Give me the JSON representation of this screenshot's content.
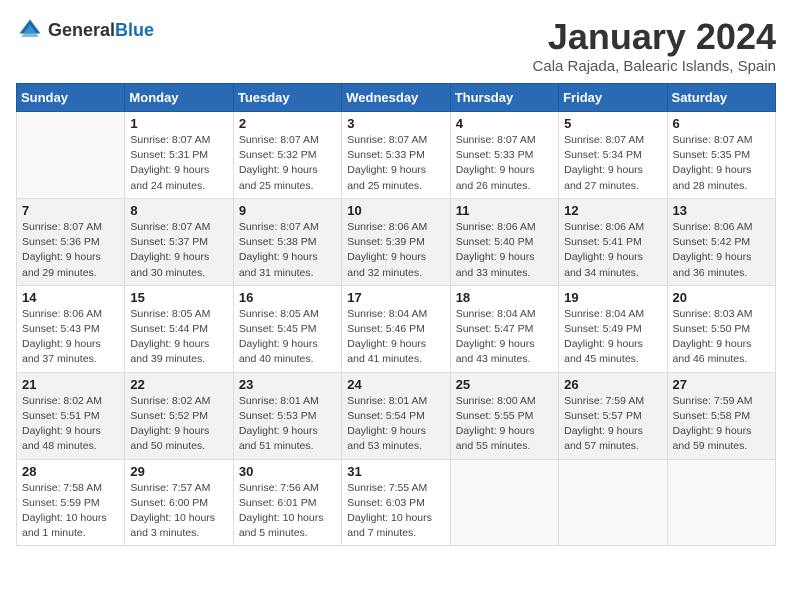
{
  "header": {
    "logo_general": "General",
    "logo_blue": "Blue",
    "title": "January 2024",
    "location": "Cala Rajada, Balearic Islands, Spain"
  },
  "weekdays": [
    "Sunday",
    "Monday",
    "Tuesday",
    "Wednesday",
    "Thursday",
    "Friday",
    "Saturday"
  ],
  "weeks": [
    [
      {
        "day": "",
        "sunrise": "",
        "sunset": "",
        "daylight": ""
      },
      {
        "day": "1",
        "sunrise": "Sunrise: 8:07 AM",
        "sunset": "Sunset: 5:31 PM",
        "daylight": "Daylight: 9 hours and 24 minutes."
      },
      {
        "day": "2",
        "sunrise": "Sunrise: 8:07 AM",
        "sunset": "Sunset: 5:32 PM",
        "daylight": "Daylight: 9 hours and 25 minutes."
      },
      {
        "day": "3",
        "sunrise": "Sunrise: 8:07 AM",
        "sunset": "Sunset: 5:33 PM",
        "daylight": "Daylight: 9 hours and 25 minutes."
      },
      {
        "day": "4",
        "sunrise": "Sunrise: 8:07 AM",
        "sunset": "Sunset: 5:33 PM",
        "daylight": "Daylight: 9 hours and 26 minutes."
      },
      {
        "day": "5",
        "sunrise": "Sunrise: 8:07 AM",
        "sunset": "Sunset: 5:34 PM",
        "daylight": "Daylight: 9 hours and 27 minutes."
      },
      {
        "day": "6",
        "sunrise": "Sunrise: 8:07 AM",
        "sunset": "Sunset: 5:35 PM",
        "daylight": "Daylight: 9 hours and 28 minutes."
      }
    ],
    [
      {
        "day": "7",
        "sunrise": "Sunrise: 8:07 AM",
        "sunset": "Sunset: 5:36 PM",
        "daylight": "Daylight: 9 hours and 29 minutes."
      },
      {
        "day": "8",
        "sunrise": "Sunrise: 8:07 AM",
        "sunset": "Sunset: 5:37 PM",
        "daylight": "Daylight: 9 hours and 30 minutes."
      },
      {
        "day": "9",
        "sunrise": "Sunrise: 8:07 AM",
        "sunset": "Sunset: 5:38 PM",
        "daylight": "Daylight: 9 hours and 31 minutes."
      },
      {
        "day": "10",
        "sunrise": "Sunrise: 8:06 AM",
        "sunset": "Sunset: 5:39 PM",
        "daylight": "Daylight: 9 hours and 32 minutes."
      },
      {
        "day": "11",
        "sunrise": "Sunrise: 8:06 AM",
        "sunset": "Sunset: 5:40 PM",
        "daylight": "Daylight: 9 hours and 33 minutes."
      },
      {
        "day": "12",
        "sunrise": "Sunrise: 8:06 AM",
        "sunset": "Sunset: 5:41 PM",
        "daylight": "Daylight: 9 hours and 34 minutes."
      },
      {
        "day": "13",
        "sunrise": "Sunrise: 8:06 AM",
        "sunset": "Sunset: 5:42 PM",
        "daylight": "Daylight: 9 hours and 36 minutes."
      }
    ],
    [
      {
        "day": "14",
        "sunrise": "Sunrise: 8:06 AM",
        "sunset": "Sunset: 5:43 PM",
        "daylight": "Daylight: 9 hours and 37 minutes."
      },
      {
        "day": "15",
        "sunrise": "Sunrise: 8:05 AM",
        "sunset": "Sunset: 5:44 PM",
        "daylight": "Daylight: 9 hours and 39 minutes."
      },
      {
        "day": "16",
        "sunrise": "Sunrise: 8:05 AM",
        "sunset": "Sunset: 5:45 PM",
        "daylight": "Daylight: 9 hours and 40 minutes."
      },
      {
        "day": "17",
        "sunrise": "Sunrise: 8:04 AM",
        "sunset": "Sunset: 5:46 PM",
        "daylight": "Daylight: 9 hours and 41 minutes."
      },
      {
        "day": "18",
        "sunrise": "Sunrise: 8:04 AM",
        "sunset": "Sunset: 5:47 PM",
        "daylight": "Daylight: 9 hours and 43 minutes."
      },
      {
        "day": "19",
        "sunrise": "Sunrise: 8:04 AM",
        "sunset": "Sunset: 5:49 PM",
        "daylight": "Daylight: 9 hours and 45 minutes."
      },
      {
        "day": "20",
        "sunrise": "Sunrise: 8:03 AM",
        "sunset": "Sunset: 5:50 PM",
        "daylight": "Daylight: 9 hours and 46 minutes."
      }
    ],
    [
      {
        "day": "21",
        "sunrise": "Sunrise: 8:02 AM",
        "sunset": "Sunset: 5:51 PM",
        "daylight": "Daylight: 9 hours and 48 minutes."
      },
      {
        "day": "22",
        "sunrise": "Sunrise: 8:02 AM",
        "sunset": "Sunset: 5:52 PM",
        "daylight": "Daylight: 9 hours and 50 minutes."
      },
      {
        "day": "23",
        "sunrise": "Sunrise: 8:01 AM",
        "sunset": "Sunset: 5:53 PM",
        "daylight": "Daylight: 9 hours and 51 minutes."
      },
      {
        "day": "24",
        "sunrise": "Sunrise: 8:01 AM",
        "sunset": "Sunset: 5:54 PM",
        "daylight": "Daylight: 9 hours and 53 minutes."
      },
      {
        "day": "25",
        "sunrise": "Sunrise: 8:00 AM",
        "sunset": "Sunset: 5:55 PM",
        "daylight": "Daylight: 9 hours and 55 minutes."
      },
      {
        "day": "26",
        "sunrise": "Sunrise: 7:59 AM",
        "sunset": "Sunset: 5:57 PM",
        "daylight": "Daylight: 9 hours and 57 minutes."
      },
      {
        "day": "27",
        "sunrise": "Sunrise: 7:59 AM",
        "sunset": "Sunset: 5:58 PM",
        "daylight": "Daylight: 9 hours and 59 minutes."
      }
    ],
    [
      {
        "day": "28",
        "sunrise": "Sunrise: 7:58 AM",
        "sunset": "Sunset: 5:59 PM",
        "daylight": "Daylight: 10 hours and 1 minute."
      },
      {
        "day": "29",
        "sunrise": "Sunrise: 7:57 AM",
        "sunset": "Sunset: 6:00 PM",
        "daylight": "Daylight: 10 hours and 3 minutes."
      },
      {
        "day": "30",
        "sunrise": "Sunrise: 7:56 AM",
        "sunset": "Sunset: 6:01 PM",
        "daylight": "Daylight: 10 hours and 5 minutes."
      },
      {
        "day": "31",
        "sunrise": "Sunrise: 7:55 AM",
        "sunset": "Sunset: 6:03 PM",
        "daylight": "Daylight: 10 hours and 7 minutes."
      },
      {
        "day": "",
        "sunrise": "",
        "sunset": "",
        "daylight": ""
      },
      {
        "day": "",
        "sunrise": "",
        "sunset": "",
        "daylight": ""
      },
      {
        "day": "",
        "sunrise": "",
        "sunset": "",
        "daylight": ""
      }
    ]
  ]
}
